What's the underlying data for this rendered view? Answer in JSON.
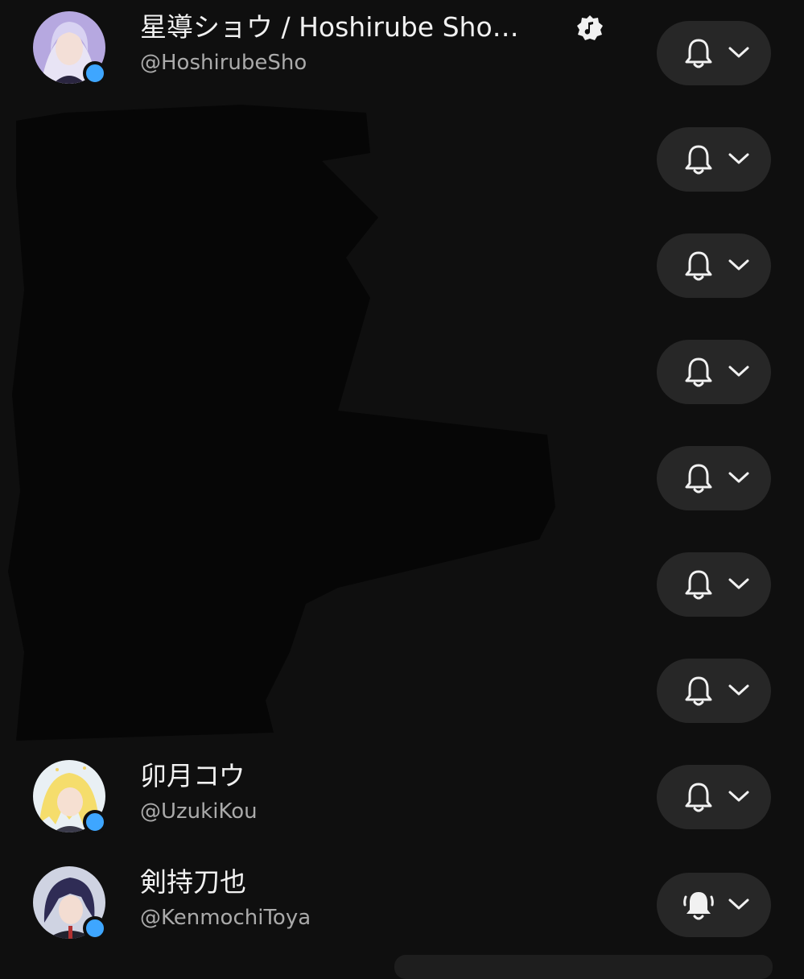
{
  "channels": [
    {
      "name": "星導ショウ / Hoshirube Sho…",
      "handle": "@HoshirubeSho",
      "avatar": "avatar-hoshirube",
      "verified_music": true,
      "bell": "outline"
    },
    {
      "name": "",
      "handle": "",
      "avatar": "",
      "bell": "outline"
    },
    {
      "name": "",
      "handle": "",
      "avatar": "",
      "bell": "outline"
    },
    {
      "name": "",
      "handle": "",
      "avatar": "",
      "bell": "outline"
    },
    {
      "name": "",
      "handle": "",
      "avatar": "",
      "bell": "outline"
    },
    {
      "name": "",
      "handle": "",
      "avatar": "",
      "bell": "outline"
    },
    {
      "name": "",
      "handle": "",
      "avatar": "",
      "bell": "outline"
    },
    {
      "name": "卯月コウ",
      "handle": "@UzukiKou",
      "avatar": "avatar-uzuki",
      "bell": "outline"
    },
    {
      "name": "剣持刀也",
      "handle": "@KenmochiToya",
      "avatar": "avatar-kenmochi",
      "bell": "all-ringing"
    }
  ],
  "icons": {
    "bell": "bell-icon",
    "bell_ringing": "bell-ringing-icon",
    "chevron": "chevron-down-icon",
    "music_badge": "official-artist-icon"
  },
  "colors": {
    "background": "#0f0f0f",
    "button": "#272727",
    "handle": "#aaaaaa",
    "live_dot": "#3ea6ff"
  }
}
